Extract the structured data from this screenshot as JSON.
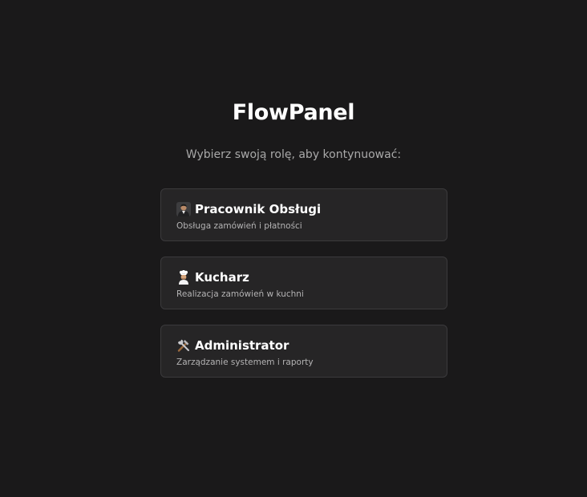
{
  "app": {
    "title": "FlowPanel",
    "subtitle": "Wybierz swoją rolę, aby kontynuować:"
  },
  "roles": [
    {
      "icon": "waiter-icon",
      "title": "Pracownik Obsługi",
      "description": "Obsługa zamówień i płatności"
    },
    {
      "icon": "chef-icon",
      "title": "Kucharz",
      "description": "Realizacja zamówień w kuchni"
    },
    {
      "icon": "tools-icon",
      "title": "Administrator",
      "description": "Zarządzanie systemem i raporty"
    }
  ],
  "colors": {
    "background": "#1a191a",
    "card_background": "#262526",
    "card_border": "#3b3a3c",
    "title_text": "#ffffff",
    "subtitle_text": "#a9a9a9"
  }
}
